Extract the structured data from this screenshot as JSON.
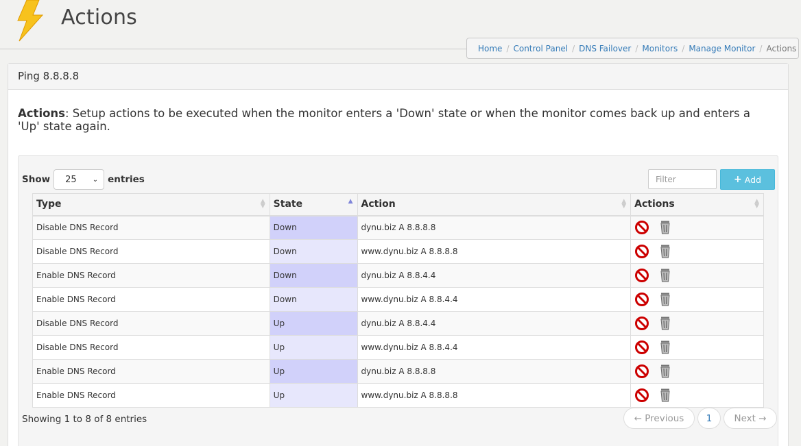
{
  "header": {
    "title": "Actions",
    "breadcrumb": [
      {
        "label": "Home",
        "link": true
      },
      {
        "label": "Control Panel",
        "link": true
      },
      {
        "label": "DNS Failover",
        "link": true
      },
      {
        "label": "Monitors",
        "link": true
      },
      {
        "label": "Manage Monitor",
        "link": true
      },
      {
        "label": "Actions",
        "link": false
      }
    ]
  },
  "panel": {
    "heading": "Ping 8.8.8.8",
    "intro_bold": "Actions",
    "intro_text": ": Setup actions to be executed when the monitor enters a 'Down' state or when the monitor comes back up and enters a 'Up' state again."
  },
  "controls": {
    "show_label": "Show",
    "entries_value": "25",
    "entries_label": "entries",
    "filter_placeholder": "Filter",
    "add_label": "Add"
  },
  "table": {
    "columns": [
      "Type",
      "State",
      "Action",
      "Actions"
    ],
    "rows": [
      {
        "type": "Disable DNS Record",
        "state": "Down",
        "action": "dynu.biz A 8.8.8.8"
      },
      {
        "type": "Disable DNS Record",
        "state": "Down",
        "action": "www.dynu.biz A 8.8.8.8"
      },
      {
        "type": "Enable DNS Record",
        "state": "Down",
        "action": "dynu.biz A 8.8.4.4"
      },
      {
        "type": "Enable DNS Record",
        "state": "Down",
        "action": "www.dynu.biz A 8.8.4.4"
      },
      {
        "type": "Disable DNS Record",
        "state": "Up",
        "action": "dynu.biz A 8.8.4.4"
      },
      {
        "type": "Disable DNS Record",
        "state": "Up",
        "action": "www.dynu.biz A 8.8.4.4"
      },
      {
        "type": "Enable DNS Record",
        "state": "Up",
        "action": "dynu.biz A 8.8.8.8"
      },
      {
        "type": "Enable DNS Record",
        "state": "Up",
        "action": "www.dynu.biz A 8.8.8.8"
      }
    ]
  },
  "footer": {
    "info": "Showing 1 to 8 of 8 entries",
    "previous_label": "← Previous",
    "page_number": "1",
    "next_label": "Next →"
  },
  "colors": {
    "accent": "#5bc0de",
    "link": "#337ab7",
    "sorted_column_odd": "#d1d1fa",
    "sorted_column_even": "#e7e7fc",
    "disable_icon": "#cc0000"
  },
  "icons": [
    "lightning-bolt-icon",
    "plus-icon",
    "disable-icon",
    "trash-icon",
    "sort-icon"
  ]
}
